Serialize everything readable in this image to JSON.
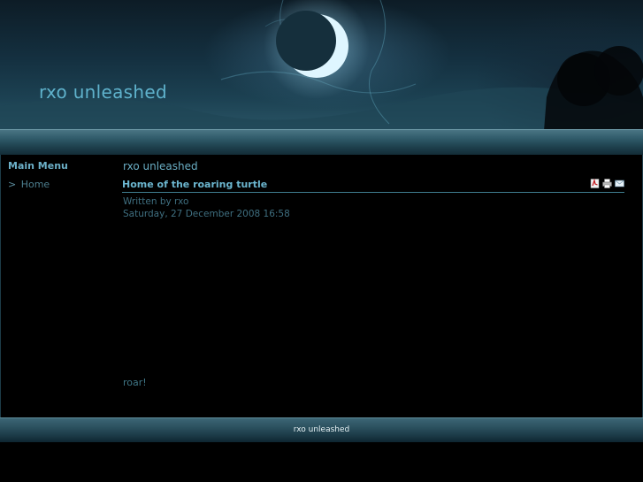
{
  "header": {
    "site_title": "rxo unleashed"
  },
  "sidebar": {
    "menu_title": "Main Menu",
    "items": [
      {
        "arrow": ">",
        "label": "Home"
      }
    ]
  },
  "content": {
    "site_name": "rxo unleashed",
    "article": {
      "title": "Home of the roaring turtle",
      "written_by": "Written by rxo",
      "date": "Saturday, 27 December 2008 16:58",
      "body": "roar!",
      "icons": [
        "pdf-icon",
        "print-icon",
        "email-icon"
      ]
    }
  },
  "footer": {
    "text": "rxo unleashed"
  },
  "colors": {
    "title": "#5fb2cc",
    "link": "#6cb6cf",
    "meta": "#3f6f80",
    "background": "#000000"
  }
}
